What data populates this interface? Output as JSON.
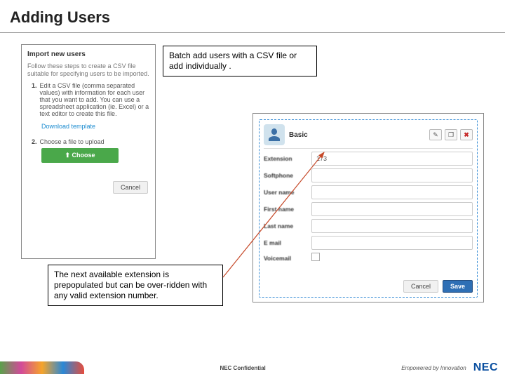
{
  "slide": {
    "title": "Adding Users",
    "callout_csv": "Batch add users with a CSV file or add individually .",
    "callout_ext": "The next available extension is prepopulated but can be over-ridden with any valid extension number."
  },
  "import_panel": {
    "title": "Import new users",
    "intro": "Follow these steps to create a CSV file suitable for specifying users to be imported.",
    "step1_label": "1.",
    "step1_text": "Edit a CSV file (comma separated values) with information for each user that you want to add. You can use a spreadsheet application (ie. Excel) or a text editor to create this file.",
    "download_link": "Download template",
    "step2_label": "2.",
    "step2_text": "Choose a file to upload",
    "choose_button": "Choose",
    "cancel_button": "Cancel"
  },
  "user_form": {
    "name": "Basic",
    "fields": {
      "extension": {
        "label": "Extension",
        "value": "173"
      },
      "softphone": {
        "label": "Softphone",
        "value": ""
      },
      "username": {
        "label": "User name",
        "value": ""
      },
      "firstname": {
        "label": "First name",
        "value": ""
      },
      "lastname": {
        "label": "Last name",
        "value": ""
      },
      "email": {
        "label": "E mail",
        "value": ""
      },
      "voicemail": {
        "label": "Voicemail"
      }
    },
    "buttons": {
      "cancel": "Cancel",
      "save": "Save"
    }
  },
  "footer": {
    "confidential": "NEC Confidential",
    "tagline": "Empowered by Innovation",
    "logo": "NEC"
  }
}
